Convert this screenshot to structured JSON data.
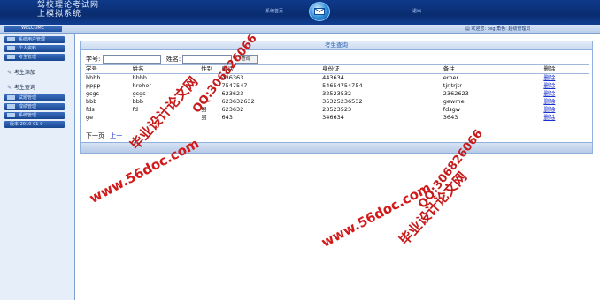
{
  "header": {
    "title_line1": "驾校理论考试网",
    "title_line2": "上模拟系统",
    "nav_left": "系统首页",
    "nav_right": "退出"
  },
  "subbar": {
    "welcome": "WELCOME",
    "info": "欢迎您: bsg 角色: 超级管理员"
  },
  "sidebar": {
    "menus": [
      {
        "label": "系统用户管理"
      },
      {
        "label": "个人资料"
      },
      {
        "label": "考生管理"
      }
    ],
    "subitems": [
      {
        "label": "考生添加"
      },
      {
        "label": "考生查询"
      }
    ],
    "menus2": [
      {
        "label": "试题管理"
      },
      {
        "label": "成绩管理"
      },
      {
        "label": "系统管理"
      },
      {
        "label": "版本 2010-01-0"
      }
    ]
  },
  "main": {
    "panel_title": "考生查询",
    "search": {
      "label_id": "学号:",
      "label_name": "姓名:",
      "button": "查询"
    },
    "table": {
      "columns": [
        "学号",
        "姓名",
        "性别",
        "电话",
        "身份证",
        "备注",
        "删除"
      ],
      "rows": [
        [
          "hhhh",
          "hhhh",
          "",
          "436363",
          "443634",
          "erher",
          "删除"
        ],
        [
          "pppp",
          "hreher",
          "",
          "7547547",
          "54654754754",
          "tjrjtrjtr",
          "删除"
        ],
        [
          "gsgs",
          "gsgs",
          "",
          "623623",
          "32523532",
          "2362623",
          "删除"
        ],
        [
          "bbb",
          "bbb",
          "",
          "623632632",
          "35325236532",
          "gewme",
          "删除"
        ],
        [
          "fds",
          "fd",
          "男",
          "623632",
          "23523523",
          "fdsgw",
          "删除"
        ],
        [
          "ge",
          "",
          "男",
          "643",
          "346634",
          "3643",
          "删除"
        ]
      ]
    },
    "pager": {
      "next": "下一页",
      "prev": "上一"
    }
  },
  "watermarks": {
    "url1": "www.56doc.com",
    "qq1": "QQ:306826066",
    "cn1": "毕业设计论文网",
    "url2": "www.56doc.com",
    "qq2": "QQ:306826066",
    "cn2": "毕业设计论文网"
  },
  "colors": {
    "header_blue": "#0e3a8a",
    "link_blue": "#1a2fd0",
    "watermark_red": "#c51b1b"
  }
}
